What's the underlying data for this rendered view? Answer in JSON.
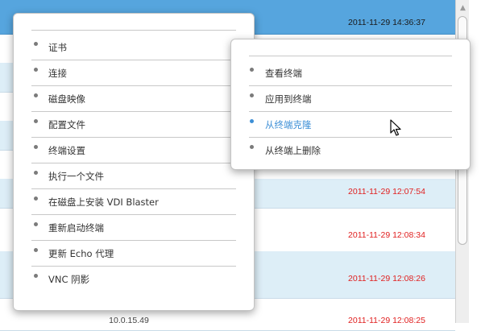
{
  "table": {
    "rows": [
      {
        "ip": "",
        "time": "2011-11-29 14:36:37",
        "style": "selected",
        "color": "dark"
      },
      {
        "ip": "",
        "time": "",
        "style": "plain",
        "color": "red"
      },
      {
        "ip": "",
        "time": "",
        "style": "striped",
        "color": "red"
      },
      {
        "ip": "",
        "time": "",
        "style": "plain",
        "color": "red"
      },
      {
        "ip": "",
        "time": "",
        "style": "striped",
        "color": "red"
      },
      {
        "ip": "",
        "time": "",
        "style": "plain",
        "color": "red"
      },
      {
        "ip": "",
        "time": "2011-11-29 12:07:54",
        "style": "striped",
        "color": "red"
      },
      {
        "ip": "",
        "time": "2011-11-29 12:08:34",
        "style": "plain",
        "color": "red"
      },
      {
        "ip": "",
        "time": "2011-11-29 12:08:26",
        "style": "striped",
        "color": "red"
      },
      {
        "ip": "10.0.15.49",
        "time": "2011-11-29 12:08:25",
        "style": "plain",
        "color": "red"
      }
    ]
  },
  "context_menu": {
    "items": [
      {
        "label": "证书"
      },
      {
        "label": "连接"
      },
      {
        "label": "磁盘映像"
      },
      {
        "label": "配置文件"
      },
      {
        "label": "终端设置"
      },
      {
        "label": "执行一个文件"
      },
      {
        "label": "在磁盘上安装 VDI Blaster"
      },
      {
        "label": "重新启动终端"
      },
      {
        "label": "更新 Echo 代理"
      },
      {
        "label": "VNC 阴影"
      }
    ]
  },
  "submenu": {
    "items": [
      {
        "label": "查看终端",
        "active": false
      },
      {
        "label": "应用到终端",
        "active": false
      },
      {
        "label": "从终端克隆",
        "active": true
      },
      {
        "label": "从终端上删除",
        "active": false
      }
    ]
  },
  "colors": {
    "selected_row": "#56a5de",
    "striped_row": "#ddeef7",
    "timestamp_red": "#e02020",
    "active_item": "#3d8fd6"
  },
  "icons": {
    "scroll_up": "chevron-up-icon",
    "cursor": "mouse-pointer-icon"
  }
}
